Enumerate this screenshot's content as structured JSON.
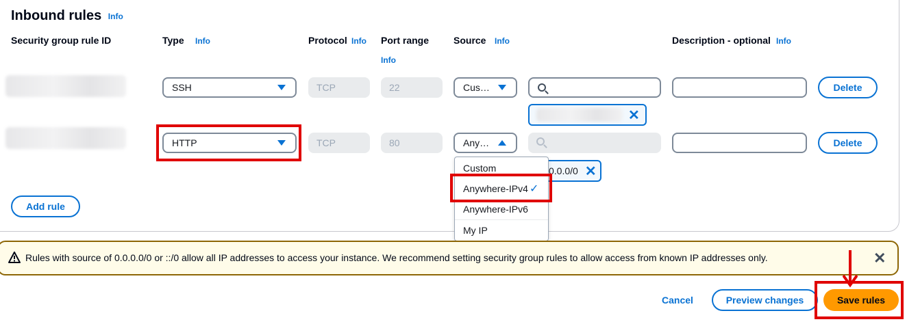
{
  "section": {
    "title": "Inbound rules",
    "info": "Info"
  },
  "columns": {
    "rule_id": "Security group rule ID",
    "type": "Type",
    "type_info": "Info",
    "protocol": "Protocol",
    "protocol_info": "Info",
    "port_range": "Port range",
    "port_range_info": "Info",
    "source": "Source",
    "source_info": "Info",
    "description": "Description - optional",
    "description_info": "Info"
  },
  "rules": [
    {
      "type": "SSH",
      "protocol": "TCP",
      "port": "22",
      "source": "Cus…",
      "delete_label": "Delete"
    },
    {
      "type": "HTTP",
      "protocol": "TCP",
      "port": "80",
      "source": "Any…",
      "cidr_token": "0.0.0/0",
      "delete_label": "Delete"
    }
  ],
  "source_dropdown": {
    "options": [
      "Custom",
      "Anywhere-IPv4",
      "Anywhere-IPv6",
      "My IP"
    ],
    "selected": "Anywhere-IPv4"
  },
  "add_rule_label": "Add rule",
  "warning": {
    "text": "Rules with source of 0.0.0.0/0 or ::/0 allow all IP addresses to access your instance. We recommend setting security group rules to allow access from known IP addresses only."
  },
  "footer": {
    "cancel": "Cancel",
    "preview": "Preview changes",
    "save": "Save rules"
  },
  "colors": {
    "link": "#0972d3",
    "primary_button": "#ff9900",
    "highlight": "#e00000",
    "warning_border": "#8d6605"
  }
}
